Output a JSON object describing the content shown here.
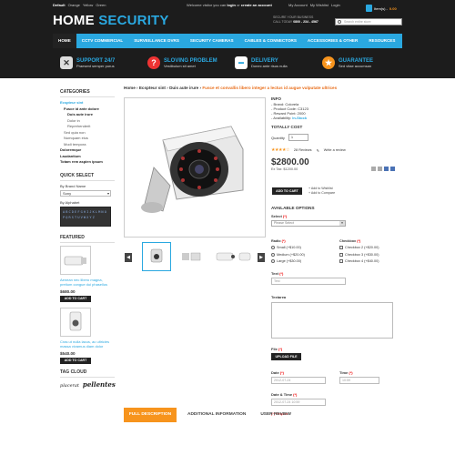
{
  "topbar": {
    "currency_label": "Default",
    "colors": [
      "Orange",
      "Yellow",
      "Green"
    ],
    "welcome_prefix": "Welcome visitor you can",
    "login": "login",
    "or": "or",
    "create_account": "create an account",
    "links": [
      "My Account",
      "My Wishlist",
      "Login"
    ],
    "cart_label": "Item(s) -",
    "cart_amount": "0.00"
  },
  "brand": {
    "home": "HOME",
    "security": "SECURITY"
  },
  "support": {
    "line1": "SECURE YOUR BUSINESS",
    "line2": "CALL TODAY",
    "phone": "0800 - 234 - 4567"
  },
  "search": {
    "placeholder": "Search entire store"
  },
  "nav": [
    "HOME",
    "CCTV COMMERCIAL",
    "SURVEILLANCE DVRS",
    "SECURITY CAMERAS",
    "CABLES & CONNECTORS",
    "ACCESSORIES & OTHER",
    "RESOURCES"
  ],
  "features": [
    {
      "title": "SUPPORT 24/7",
      "sub": "Praesent semper purus",
      "icon": "tools-icon",
      "color": "#2d6a2d"
    },
    {
      "title": "SLOVING PROBLEM",
      "sub": "Vestibulum sit amet",
      "icon": "help-icon",
      "color": "#e33"
    },
    {
      "title": "DELIVERY",
      "sub": "Donec ante risus nulla",
      "icon": "truck-icon",
      "color": "#2aa8e0"
    },
    {
      "title": "GUARANTEE",
      "sub": "Sed vitae accumsan",
      "icon": "medal-icon",
      "color": "#f7941d"
    }
  ],
  "sidebar": {
    "categories_title": "CATEGORIES",
    "categories": [
      {
        "label": "Ecspteur sint",
        "cls": "sel"
      },
      {
        "label": "Fusce id ante dolore",
        "cls": "b sub"
      },
      {
        "label": "Duis aute irure",
        "cls": "b subsub"
      },
      {
        "label": "Dolor in",
        "cls": "subsub"
      },
      {
        "label": "Reprehenderit",
        "cls": "subsub"
      },
      {
        "label": "Sed quia non",
        "cls": "sub"
      },
      {
        "label": "Numquam eius",
        "cls": "sub"
      },
      {
        "label": "Modi tempora",
        "cls": "sub"
      },
      {
        "label": "Doloremque",
        "cls": "b"
      },
      {
        "label": "Laudantium",
        "cls": "b"
      },
      {
        "label": "Totam rem aspien ipsum",
        "cls": "b"
      }
    ],
    "quick_select_title": "QUICK SELECT",
    "by_brand": "By Brand Name",
    "brand_value": "Sony",
    "by_alphabet": "By Alphabet",
    "alphabet": "ABCDEFGHIJKLMNOPQRSTUVWXYZ",
    "featured_title": "FEATURED",
    "featured": [
      {
        "name": "Aenean nec libero magna, pretium congue dui phasellus",
        "price": "$680.00",
        "btn": "ADD TO CART"
      },
      {
        "name": "Cras ut nulla lacus, ac ultricies massa vivamus diam dolor",
        "price": "$540.00",
        "btn": "ADD TO CART"
      }
    ],
    "tag_title": "TAG CLOUD",
    "tags": [
      "placerat",
      "pellentes"
    ]
  },
  "breadcrumb": [
    "Home",
    "Ecspteur sint",
    "Duis aute irure",
    "Fusce et convallis libero integer a lectus id augue vulputate ultrices"
  ],
  "product": {
    "info_title": "INFO",
    "brand": "- Brand: Colorela",
    "code": "- Product Code: C3123",
    "points": "- Reward Point: 2000",
    "availability_label": "- Availability:",
    "availability_value": "In-Stock",
    "cost_title": "TOTALLY COST",
    "quantity_label": "Quantity",
    "quantity_value": "1",
    "rating": 4,
    "reviews": "28 Reviews",
    "write_review": "Write a review",
    "price": "$2800.00",
    "ex_tax": "Ex Tax: $1200.00",
    "add_to_cart": "ADD TO CART",
    "add_wishlist": "+ Add to Wishlist",
    "add_compare": "+ Add to Compare"
  },
  "options": {
    "title": "AVAILABLE OPTIONS",
    "select_label": "Select",
    "select_value": "Please Select",
    "radio_label": "Radio",
    "radios": [
      "Small (+$10.00)",
      "Medium (+$20.00)",
      "Large (+$30.00)"
    ],
    "checkbox_label": "Checkbox",
    "checks": [
      "Checkbox 2 (+$20.00)",
      "Checkbox 3 (+$30.00)",
      "Checkbox 4 (+$40.00)"
    ],
    "text_label": "Text",
    "text_value": "Test",
    "textarea_label": "Textarea",
    "file_label": "File",
    "upload_btn": "UPLOAD FILE",
    "date_label": "Date",
    "date_value": "2012-07-24",
    "time_label": "Time",
    "time_value": "10:59",
    "datetime_label": "Date & Time",
    "datetime_value": "2012-07-24 10:59",
    "required": "Require"
  },
  "tabs": [
    "FULL DESCRIPTION",
    "ADDITIONAL INFORMATION",
    "USER REVIEW"
  ]
}
